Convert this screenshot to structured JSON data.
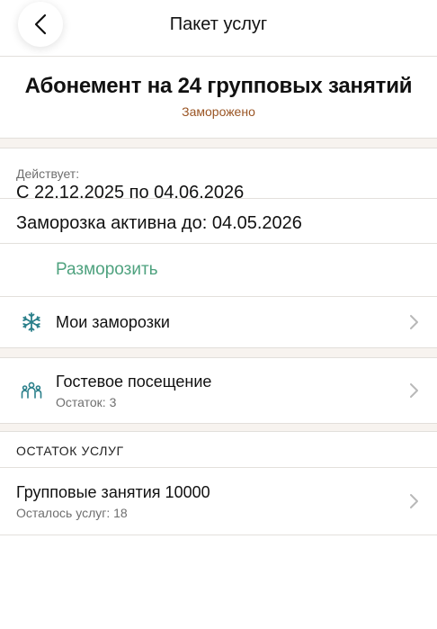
{
  "header": {
    "title": "Пакет услуг",
    "back_icon": "chevron-left-icon"
  },
  "package": {
    "title": "Абонемент на 24 групповых занятий",
    "status": "Заморожено",
    "status_color": "#9a5524"
  },
  "validity": {
    "label": "Действует:",
    "value": "С 22.12.2025 по 04.06.2026"
  },
  "freeze": {
    "active_until": "Заморозка активна до: 04.05.2026",
    "unfreeze_label": "Разморозить",
    "accent_color": "#4fa27f"
  },
  "menu": {
    "my_freezes": {
      "label": "Мои заморозки",
      "icon": "snowflake-icon"
    },
    "guest_visit": {
      "label": "Гостевое посещение",
      "sub": "Остаток: 3",
      "icon": "group-people-icon"
    }
  },
  "services": {
    "section_title": "ОСТАТОК УСЛУГ",
    "items": [
      {
        "title": "Групповые занятия 10000",
        "sub": "Осталось услуг: 18"
      }
    ]
  }
}
